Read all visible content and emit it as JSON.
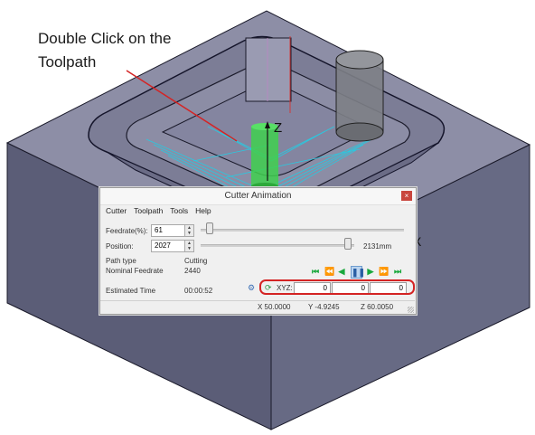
{
  "callout": {
    "line1": "Double Click on the",
    "line2": "Toolpath"
  },
  "scene": {
    "z_axis_label": "Z",
    "x_axis_label": "X"
  },
  "window": {
    "title": "Cutter Animation",
    "close_glyph": "×",
    "menu": [
      "Cutter",
      "Toolpath",
      "Tools",
      "Help"
    ],
    "feedrate_label": "Feedrate(%):",
    "feedrate_value": "61",
    "position_label": "Position:",
    "position_value": "2027",
    "position_max": "2131mm",
    "path_type_label": "Path type",
    "path_type_value": "Cutting",
    "nominal_feedrate_label": "Nominal Feedrate",
    "nominal_feedrate_value": "2440",
    "estimated_time_label": "Estimated Time",
    "estimated_time_value": "00:00:52",
    "xyz_label": "XYZ:",
    "xyz_values": [
      "0",
      "0",
      "0"
    ],
    "feedrate_slider_fraction": 0.04,
    "position_slider_fraction": 0.95,
    "playback_icons": [
      "first-icon",
      "step-back-icon",
      "rewind-icon",
      "pause-icon",
      "play-icon",
      "step-forward-icon",
      "last-icon"
    ],
    "status": {
      "x": "X  50.0000",
      "y": "Y  -4.9245",
      "z": "Z  60.0050"
    }
  },
  "colors": {
    "block_top": "#8c8ca4",
    "block_side": "#5c5e78",
    "toolpath": "#29c9e0",
    "tool_green": "#3fd04f",
    "highlight": "#d42424"
  }
}
